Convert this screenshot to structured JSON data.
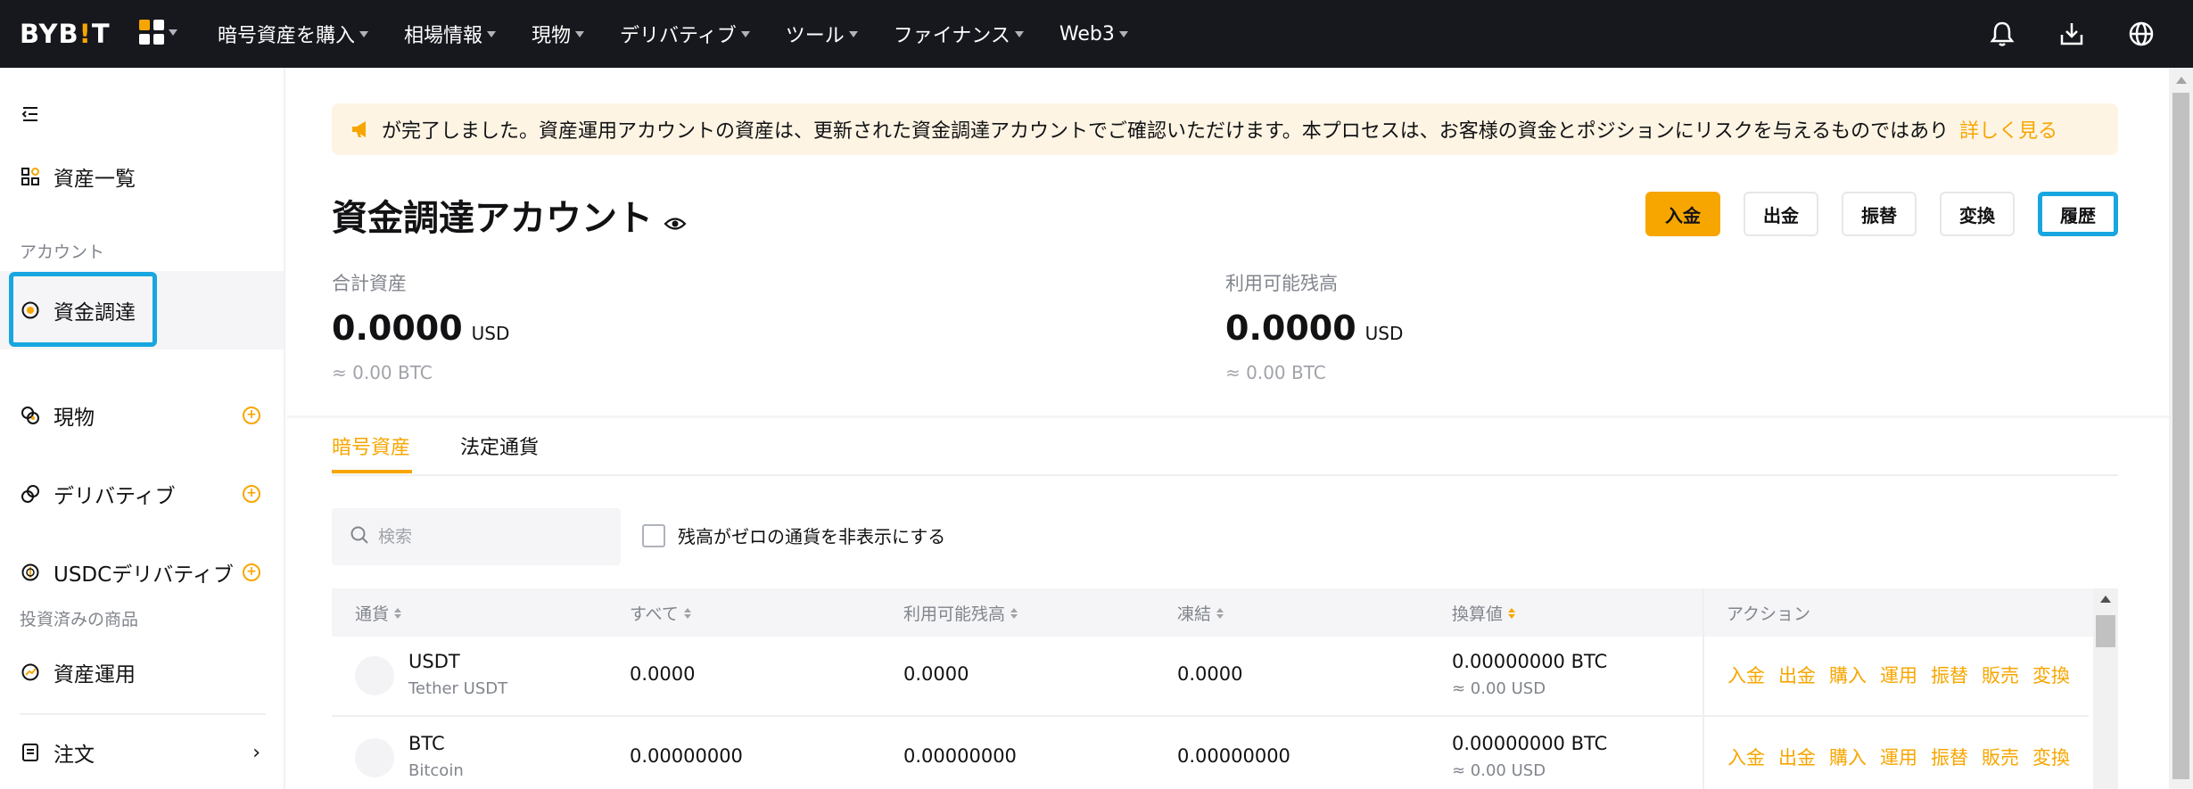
{
  "nav": {
    "logo_prefix": "BYB",
    "logo_bang": "!",
    "logo_suffix": "T",
    "items": [
      {
        "label": "暗号資産を購入"
      },
      {
        "label": "相場情報"
      },
      {
        "label": "現物"
      },
      {
        "label": "デリバティブ"
      },
      {
        "label": "ツール"
      },
      {
        "label": "ファイナンス"
      },
      {
        "label": "Web3"
      }
    ],
    "icons": [
      "bell-icon",
      "download-icon",
      "globe-icon"
    ]
  },
  "sidebar": {
    "overview": "資産一覧",
    "section_account": "アカウント",
    "funding": "資金調達",
    "spot": "現物",
    "derivatives": "デリバティブ",
    "usdc_derivatives": "USDCデリバティブ",
    "section_invested": "投資済みの商品",
    "earn": "資産運用",
    "orders": "注文"
  },
  "banner": {
    "text": "が完了しました。資産運用アカウントの資産は、更新された資金調達アカウントでご確認いただけます。本プロセスは、お客様の資金とポジションにリスクを与えるものではあり",
    "link": "詳しく見る"
  },
  "account": {
    "title": "資金調達アカウント",
    "buttons": {
      "deposit": "入金",
      "withdraw": "出金",
      "transfer": "振替",
      "convert": "変換",
      "history": "履歴"
    },
    "total_label": "合計資産",
    "total_value": "0.0000",
    "total_unit": "USD",
    "total_btc": "≈ 0.00 BTC",
    "available_label": "利用可能残高",
    "available_value": "0.0000",
    "available_unit": "USD",
    "available_btc": "≈ 0.00 BTC"
  },
  "tabs": {
    "crypto": "暗号資産",
    "fiat": "法定通貨"
  },
  "filters": {
    "search_placeholder": "検索",
    "hide_zero": "残高がゼロの通貨を非表示にする"
  },
  "table": {
    "headers": {
      "coin": "通貨",
      "all": "すべて",
      "available": "利用可能残高",
      "frozen": "凍結",
      "equivalent": "換算値",
      "actions": "アクション"
    },
    "rows": [
      {
        "symbol": "USDT",
        "name": "Tether USDT",
        "all": "0.0000",
        "available": "0.0000",
        "frozen": "0.0000",
        "btc_value": "0.00000000 BTC",
        "usd_value": "≈ 0.00 USD",
        "actions": [
          "入金",
          "出金",
          "購入",
          "運用",
          "振替",
          "販売",
          "変換"
        ]
      },
      {
        "symbol": "BTC",
        "name": "Bitcoin",
        "all": "0.00000000",
        "available": "0.00000000",
        "frozen": "0.00000000",
        "btc_value": "0.00000000 BTC",
        "usd_value": "≈ 0.00 USD",
        "actions": [
          "入金",
          "出金",
          "購入",
          "運用",
          "振替",
          "販売",
          "変換"
        ]
      }
    ]
  },
  "colors": {
    "accent": "#f7a600",
    "highlight": "#18a6e0",
    "nav_bg": "#17181e"
  }
}
